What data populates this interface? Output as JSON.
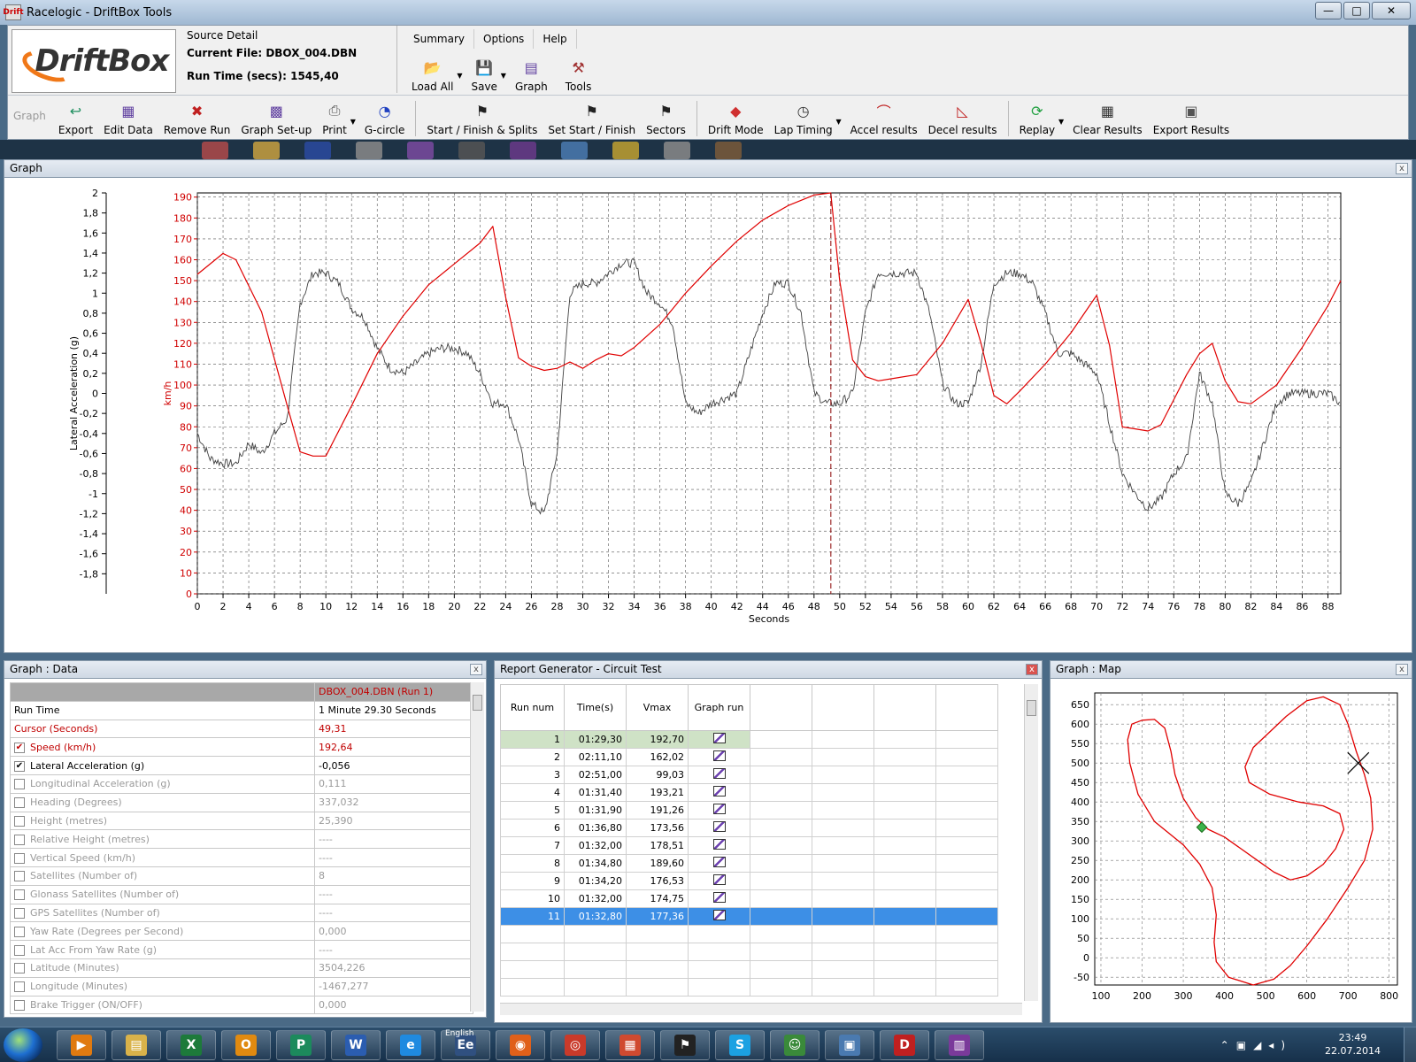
{
  "window": {
    "title": "Racelogic - DriftBox Tools",
    "min": "—",
    "max": "□",
    "close": "✕",
    "app_icon": "Drift"
  },
  "logo": {
    "text": "DriftBox"
  },
  "source": {
    "header": "Source Detail",
    "current_file": "Current File: DBOX_004.DBN",
    "run_time": "Run Time (secs): 1545,40"
  },
  "menus": [
    "Summary",
    "Options",
    "Help"
  ],
  "top_buttons": [
    {
      "label": "Load All",
      "icon": "folder-icon",
      "dropdown": true
    },
    {
      "label": "Save",
      "icon": "floppy-icon",
      "dropdown": true
    },
    {
      "label": "Graph",
      "icon": "graph-icon",
      "dropdown": false
    },
    {
      "label": "Tools",
      "icon": "tools-icon",
      "dropdown": false
    }
  ],
  "toolbar": {
    "group_label": "Graph",
    "buttons": [
      {
        "label": "Export",
        "icon": "export-icon"
      },
      {
        "label": "Edit Data",
        "icon": "edit-data-icon"
      },
      {
        "label": "Remove Run",
        "icon": "remove-run-icon"
      },
      {
        "label": "Graph Set-up",
        "icon": "graph-setup-icon"
      },
      {
        "label": "Print",
        "icon": "printer-icon",
        "dropdown": true
      },
      {
        "label": "G-circle",
        "icon": "g-circle-icon"
      },
      {
        "label": "Start / Finish & Splits",
        "icon": "checkered-flag-icon"
      },
      {
        "label": "Set Start / Finish",
        "icon": "set-flag-icon"
      },
      {
        "label": "Sectors",
        "icon": "sectors-icon"
      },
      {
        "label": "Drift Mode",
        "icon": "drift-mode-icon"
      },
      {
        "label": "Lap Timing",
        "icon": "stopwatch-icon",
        "dropdown": true
      },
      {
        "label": "Accel results",
        "icon": "accel-icon"
      },
      {
        "label": "Decel results",
        "icon": "decel-icon"
      },
      {
        "label": "Replay",
        "icon": "replay-icon",
        "dropdown": true
      },
      {
        "label": "Clear Results",
        "icon": "clear-results-icon"
      },
      {
        "label": "Export Results",
        "icon": "export-results-icon"
      }
    ]
  },
  "graph_panel": {
    "title": "Graph",
    "close": "x",
    "y_left_label": "Lateral Acceleration (g)",
    "y_right_label": "km/h",
    "x_label": "Seconds",
    "x_ticks": [
      "0",
      "2",
      "4",
      "6",
      "8",
      "10",
      "12",
      "14",
      "16",
      "18",
      "20",
      "22",
      "24",
      "26",
      "28",
      "30",
      "32",
      "34",
      "36",
      "38",
      "40",
      "42",
      "44",
      "46",
      "48",
      "50",
      "52",
      "54",
      "56",
      "58",
      "60",
      "62",
      "64",
      "66",
      "68",
      "70",
      "72",
      "74",
      "76",
      "78",
      "80",
      "82",
      "84",
      "86",
      "88"
    ],
    "speed_ticks": [
      "0",
      "10",
      "20",
      "30",
      "40",
      "50",
      "60",
      "70",
      "80",
      "90",
      "100",
      "110",
      "120",
      "130",
      "140",
      "150",
      "160",
      "170",
      "180",
      "190"
    ],
    "g_ticks": [
      "2",
      "1,8",
      "1,6",
      "1,4",
      "1,2",
      "1",
      "0,8",
      "0,6",
      "0,4",
      "0,2",
      "0",
      "-0,2",
      "-0,4",
      "-0,6",
      "-0,8",
      "-1",
      "-1,2",
      "-1,4",
      "-1,6",
      "-1,8"
    ],
    "cursor_seconds": 49.31,
    "speed_color": "#e00000",
    "lat_color": "#404040"
  },
  "chart_data": {
    "type": "line",
    "xlabel": "Seconds",
    "xlim": [
      0,
      89
    ],
    "series": [
      {
        "name": "Speed (km/h)",
        "axis": "right",
        "ylim": [
          0,
          192
        ],
        "x": [
          0,
          2,
          3,
          5,
          7,
          8,
          9,
          10,
          12,
          14,
          16,
          18,
          20,
          22,
          23,
          24,
          25,
          26,
          27,
          28,
          29,
          30,
          31,
          32,
          33,
          34,
          36,
          38,
          40,
          42,
          44,
          46,
          48,
          49.3,
          50,
          51,
          52,
          53,
          54,
          56,
          58,
          60,
          61,
          62,
          63,
          64,
          66,
          68,
          70,
          71,
          72,
          73,
          74,
          75,
          76,
          77,
          78,
          79,
          80,
          81,
          82,
          84,
          86,
          88,
          89
        ],
        "y": [
          153,
          163,
          160,
          135,
          90,
          68,
          66,
          66,
          90,
          115,
          133,
          148,
          158,
          168,
          176,
          142,
          113,
          109,
          107,
          108,
          111,
          108,
          112,
          115,
          114,
          118,
          129,
          144,
          157,
          169,
          179,
          186,
          191,
          192,
          150,
          112,
          104,
          102,
          103,
          105,
          120,
          141,
          120,
          95,
          91,
          97,
          110,
          125,
          143,
          119,
          80,
          79,
          78,
          81,
          93,
          105,
          115,
          120,
          102,
          92,
          91,
          100,
          118,
          138,
          150
        ]
      },
      {
        "name": "Lateral Acceleration (g)",
        "axis": "left",
        "ylim": [
          -2,
          2
        ],
        "x": [
          0,
          1,
          2,
          3,
          4,
          5,
          6,
          7,
          8,
          9,
          10,
          11,
          12,
          13,
          14,
          15,
          16,
          17,
          18,
          19,
          20,
          21,
          22,
          23,
          24,
          25,
          26,
          27,
          28,
          29,
          30,
          31,
          32,
          33,
          34,
          35,
          36,
          37,
          38,
          39,
          40,
          41,
          42,
          43,
          44,
          45,
          46,
          47,
          48,
          49,
          50,
          51,
          52,
          53,
          54,
          55,
          56,
          57,
          58,
          59,
          60,
          61,
          62,
          63,
          64,
          65,
          66,
          67,
          68,
          69,
          70,
          71,
          72,
          73,
          74,
          75,
          76,
          77,
          78,
          79,
          80,
          81,
          82,
          83,
          84,
          85,
          86,
          87,
          88,
          89
        ],
        "y": [
          -0.4,
          -0.65,
          -0.7,
          -0.7,
          -0.5,
          -0.6,
          -0.4,
          -0.25,
          0.9,
          1.2,
          1.2,
          1.1,
          0.85,
          0.75,
          0.45,
          0.25,
          0.2,
          0.3,
          0.4,
          0.45,
          0.45,
          0.4,
          0.2,
          -0.1,
          -0.1,
          -0.45,
          -1.1,
          -1.2,
          -0.6,
          1.0,
          1.1,
          1.1,
          1.2,
          1.3,
          1.3,
          1.0,
          0.9,
          0.7,
          -0.1,
          -0.2,
          -0.1,
          -0.05,
          0,
          0.4,
          0.8,
          1.1,
          1.1,
          0.8,
          0.0,
          -0.1,
          -0.1,
          0.0,
          0.8,
          1.2,
          1.2,
          1.2,
          1.2,
          0.8,
          0.1,
          -0.1,
          -0.1,
          0.3,
          1.1,
          1.2,
          1.2,
          1.1,
          0.8,
          0.4,
          0.4,
          0.3,
          0.2,
          -0.3,
          -0.8,
          -1.0,
          -1.15,
          -1.05,
          -0.8,
          -0.65,
          0.2,
          -0.1,
          -1.0,
          -1.1,
          -0.9,
          -0.5,
          -0.1,
          0.0,
          0.0,
          0.0,
          0.0,
          -0.1
        ]
      }
    ],
    "cursor_x": 49.31,
    "grid": true
  },
  "data_panel": {
    "title": "Graph : Data",
    "close": "x",
    "run_header": "DBOX_004.DBN (Run 1)",
    "rows": [
      {
        "label": "Run Time",
        "value": "1 Minute 29.30 Seconds",
        "style": "normal",
        "checkbox": "none"
      },
      {
        "label": "Cursor (Seconds)",
        "value": "49,31",
        "style": "red",
        "checkbox": "none"
      },
      {
        "label": "Speed (km/h)",
        "value": "192,64",
        "style": "red",
        "checkbox": "checked"
      },
      {
        "label": "Lateral Acceleration (g)",
        "value": "-0,056",
        "style": "normal",
        "checkbox": "checked"
      },
      {
        "label": "Longitudinal Acceleration (g)",
        "value": "0,111",
        "style": "dim",
        "checkbox": "unchecked"
      },
      {
        "label": "Heading (Degrees)",
        "value": "337,032",
        "style": "dim",
        "checkbox": "unchecked"
      },
      {
        "label": "Height (metres)",
        "value": "25,390",
        "style": "dim",
        "checkbox": "unchecked"
      },
      {
        "label": "Relative Height (metres)",
        "value": "----",
        "style": "dim",
        "checkbox": "unchecked"
      },
      {
        "label": "Vertical Speed (km/h)",
        "value": "----",
        "style": "dim",
        "checkbox": "unchecked"
      },
      {
        "label": "Satellites (Number of)",
        "value": "8",
        "style": "dim",
        "checkbox": "unchecked"
      },
      {
        "label": "Glonass Satellites (Number of)",
        "value": "----",
        "style": "dim",
        "checkbox": "unchecked"
      },
      {
        "label": "GPS Satellites (Number of)",
        "value": "----",
        "style": "dim",
        "checkbox": "unchecked"
      },
      {
        "label": "Yaw Rate (Degrees per Second)",
        "value": "0,000",
        "style": "dim",
        "checkbox": "unchecked"
      },
      {
        "label": "Lat Acc From Yaw Rate (g)",
        "value": "----",
        "style": "dim",
        "checkbox": "unchecked"
      },
      {
        "label": "Latitude (Minutes)",
        "value": "3504,226",
        "style": "dim",
        "checkbox": "unchecked"
      },
      {
        "label": "Longitude (Minutes)",
        "value": "-1467,277",
        "style": "dim",
        "checkbox": "unchecked"
      },
      {
        "label": "Brake Trigger (ON/OFF)",
        "value": "0,000",
        "style": "dim",
        "checkbox": "unchecked"
      }
    ]
  },
  "report_panel": {
    "title": "Report Generator - Circuit Test",
    "close": "x",
    "columns": [
      "Run num",
      "Time(s)",
      "Vmax",
      "Graph run"
    ],
    "rows": [
      {
        "run": "1",
        "time": "01:29,30",
        "vmax": "192,70",
        "state": "first"
      },
      {
        "run": "2",
        "time": "02:11,10",
        "vmax": "162,02",
        "state": ""
      },
      {
        "run": "3",
        "time": "02:51,00",
        "vmax": "99,03",
        "state": ""
      },
      {
        "run": "4",
        "time": "01:31,40",
        "vmax": "193,21",
        "state": ""
      },
      {
        "run": "5",
        "time": "01:31,90",
        "vmax": "191,26",
        "state": ""
      },
      {
        "run": "6",
        "time": "01:36,80",
        "vmax": "173,56",
        "state": ""
      },
      {
        "run": "7",
        "time": "01:32,00",
        "vmax": "178,51",
        "state": ""
      },
      {
        "run": "8",
        "time": "01:34,80",
        "vmax": "189,60",
        "state": ""
      },
      {
        "run": "9",
        "time": "01:34,20",
        "vmax": "176,53",
        "state": ""
      },
      {
        "run": "10",
        "time": "01:32,00",
        "vmax": "174,75",
        "state": ""
      },
      {
        "run": "11",
        "time": "01:32,80",
        "vmax": "177,36",
        "state": "selected"
      }
    ]
  },
  "map_panel": {
    "title": "Graph : Map",
    "close": "x",
    "x_ticks": [
      "100",
      "200",
      "300",
      "400",
      "500",
      "600",
      "700",
      "800"
    ],
    "y_ticks": [
      "650",
      "600",
      "550",
      "500",
      "450",
      "400",
      "350",
      "300",
      "250",
      "200",
      "150",
      "100",
      "50",
      "0",
      "-50"
    ],
    "track_color": "#e00000",
    "cursor_point": {
      "x": 345,
      "y": 335
    },
    "cross_point": {
      "x": 725,
      "y": 500
    }
  },
  "taskbar": {
    "time": "23:49",
    "date": "22.07.2014",
    "apps": [
      {
        "name": "media-player-icon",
        "glyph": "▶",
        "color": "#e07a10"
      },
      {
        "name": "explorer-icon",
        "glyph": "▤",
        "color": "#d9b24a"
      },
      {
        "name": "excel-icon",
        "glyph": "X",
        "color": "#1d7a3a"
      },
      {
        "name": "outlook-icon",
        "glyph": "O",
        "color": "#e08a10"
      },
      {
        "name": "publisher-icon",
        "glyph": "P",
        "color": "#1c8a5c"
      },
      {
        "name": "word-icon",
        "glyph": "W",
        "color": "#2b5db0"
      },
      {
        "name": "internet-explorer-icon",
        "glyph": "e",
        "color": "#1f8ae0"
      },
      {
        "name": "language-icon",
        "glyph": "Ee",
        "color": "#305080"
      },
      {
        "name": "firefox-icon",
        "glyph": "◉",
        "color": "#e0601a"
      },
      {
        "name": "chrome-icon",
        "glyph": "◎",
        "color": "#c93a2a"
      },
      {
        "name": "apps-icon",
        "glyph": "▦",
        "color": "#d04a30"
      },
      {
        "name": "racing-flag-icon",
        "glyph": "⚑",
        "color": "#222222"
      },
      {
        "name": "skype-icon",
        "glyph": "S",
        "color": "#1ba1e2"
      },
      {
        "name": "people-icon",
        "glyph": "☺",
        "color": "#3a8a3a"
      },
      {
        "name": "remote-desktop-icon",
        "glyph": "▣",
        "color": "#4a7ab0"
      },
      {
        "name": "driftbox-icon",
        "glyph": "D",
        "color": "#c02020"
      },
      {
        "name": "winrar-icon",
        "glyph": "▥",
        "color": "#7a3a9a"
      }
    ],
    "language_label": "English"
  }
}
